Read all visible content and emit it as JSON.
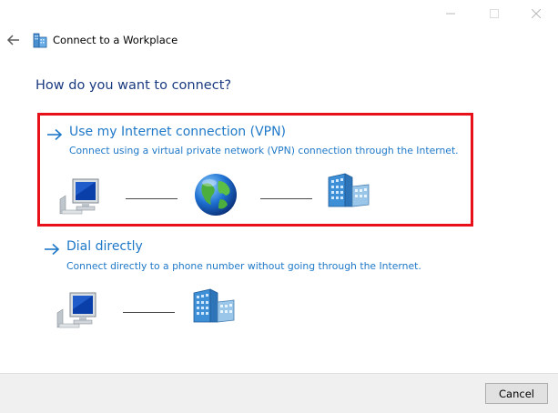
{
  "window": {
    "title": "Connect to a Workplace",
    "controls": {
      "minimize": "minimize-icon",
      "maximize": "maximize-icon",
      "close": "close-icon"
    }
  },
  "nav": {
    "back_icon": "back-arrow-icon",
    "app_icon": "workplace-network-icon"
  },
  "heading": "How do you want to connect?",
  "options": [
    {
      "title": "Use my Internet connection (VPN)",
      "description": "Connect using a virtual private network (VPN) connection through the Internet.",
      "icons": [
        "computer-icon",
        "globe-icon",
        "building-icon"
      ],
      "selected": true
    },
    {
      "title": "Dial directly",
      "description": "Connect directly to a phone number without going through the Internet.",
      "icons": [
        "computer-icon",
        "building-icon"
      ],
      "selected": false
    }
  ],
  "footer": {
    "cancel_label": "Cancel"
  },
  "colors": {
    "link": "#1e78c8",
    "heading": "#1a3a80",
    "highlight_border": "#e8111a",
    "footer_bg": "#f0f0f0"
  }
}
